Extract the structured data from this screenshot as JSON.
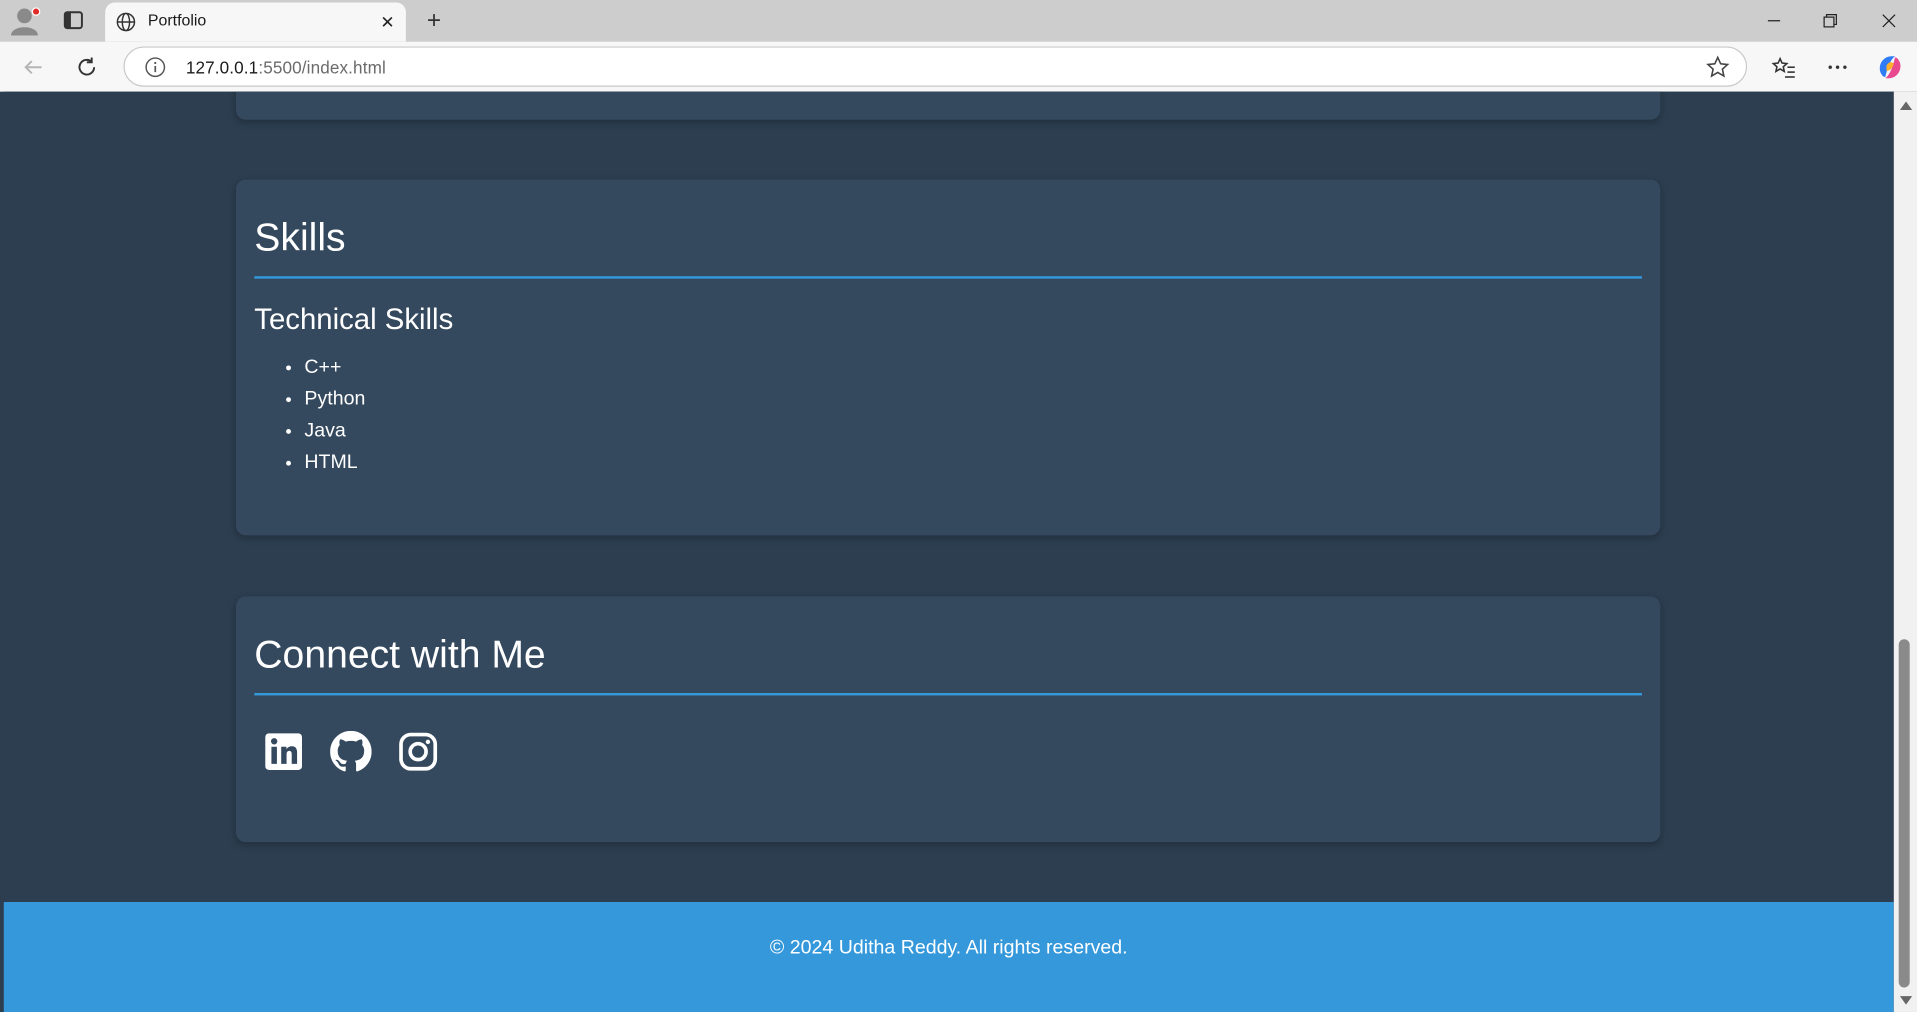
{
  "browser": {
    "tab_title": "Portfolio",
    "url_host": "127.0.0.1",
    "url_rest": ":5500/index.html",
    "icons": [
      "profile-icon",
      "tab-actions-icon",
      "globe-icon",
      "close-tab-icon",
      "new-tab-icon",
      "minimize-icon",
      "restore-icon",
      "close-window-icon",
      "back-icon",
      "refresh-icon",
      "site-info-icon",
      "favorite-star-icon",
      "favorites-icon",
      "more-icon",
      "copilot-icon"
    ]
  },
  "skills": {
    "heading": "Skills",
    "subheading": "Technical Skills",
    "items": [
      "C++",
      "Python",
      "Java",
      "HTML"
    ]
  },
  "connect": {
    "heading": "Connect with Me",
    "links": [
      "linkedin-icon",
      "github-icon",
      "instagram-icon"
    ]
  },
  "footer": {
    "text": "© 2024 Uditha Reddy. All rights reserved."
  },
  "colors": {
    "page_bg": "#2c3e50",
    "card_bg": "#34495e",
    "accent": "#3498db",
    "text": "#ffffff"
  }
}
